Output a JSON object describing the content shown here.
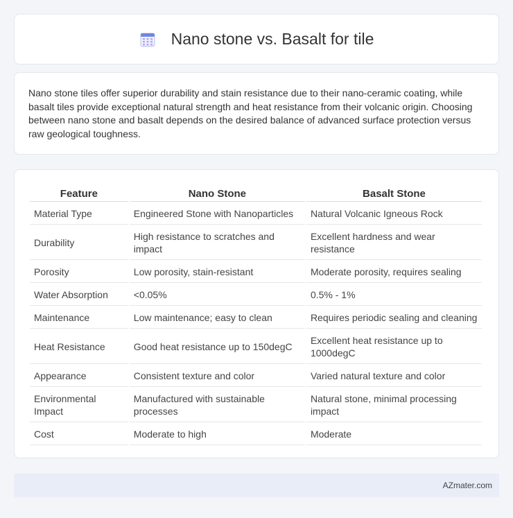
{
  "header": {
    "title": "Nano stone vs. Basalt for tile",
    "icon": "calendar-icon",
    "icon_color": "#7a8fe0"
  },
  "intro": {
    "text": "Nano stone tiles offer superior durability and stain resistance due to their nano-ceramic coating, while basalt tiles provide exceptional natural strength and heat resistance from their volcanic origin. Choosing between nano stone and basalt depends on the desired balance of advanced surface protection versus raw geological toughness."
  },
  "table": {
    "headers": [
      "Feature",
      "Nano Stone",
      "Basalt Stone"
    ],
    "rows": [
      [
        "Material Type",
        "Engineered Stone with Nanoparticles",
        "Natural Volcanic Igneous Rock"
      ],
      [
        "Durability",
        "High resistance to scratches and impact",
        "Excellent hardness and wear resistance"
      ],
      [
        "Porosity",
        "Low porosity, stain-resistant",
        "Moderate porosity, requires sealing"
      ],
      [
        "Water Absorption",
        "<0.05%",
        "0.5% - 1%"
      ],
      [
        "Maintenance",
        "Low maintenance; easy to clean",
        "Requires periodic sealing and cleaning"
      ],
      [
        "Heat Resistance",
        "Good heat resistance up to 150degC",
        "Excellent heat resistance up to 1000degC"
      ],
      [
        "Appearance",
        "Consistent texture and color",
        "Varied natural texture and color"
      ],
      [
        "Environmental Impact",
        "Manufactured with sustainable processes",
        "Natural stone, minimal processing impact"
      ],
      [
        "Cost",
        "Moderate to high",
        "Moderate"
      ]
    ]
  },
  "footer": {
    "text": "AZmater.com"
  }
}
